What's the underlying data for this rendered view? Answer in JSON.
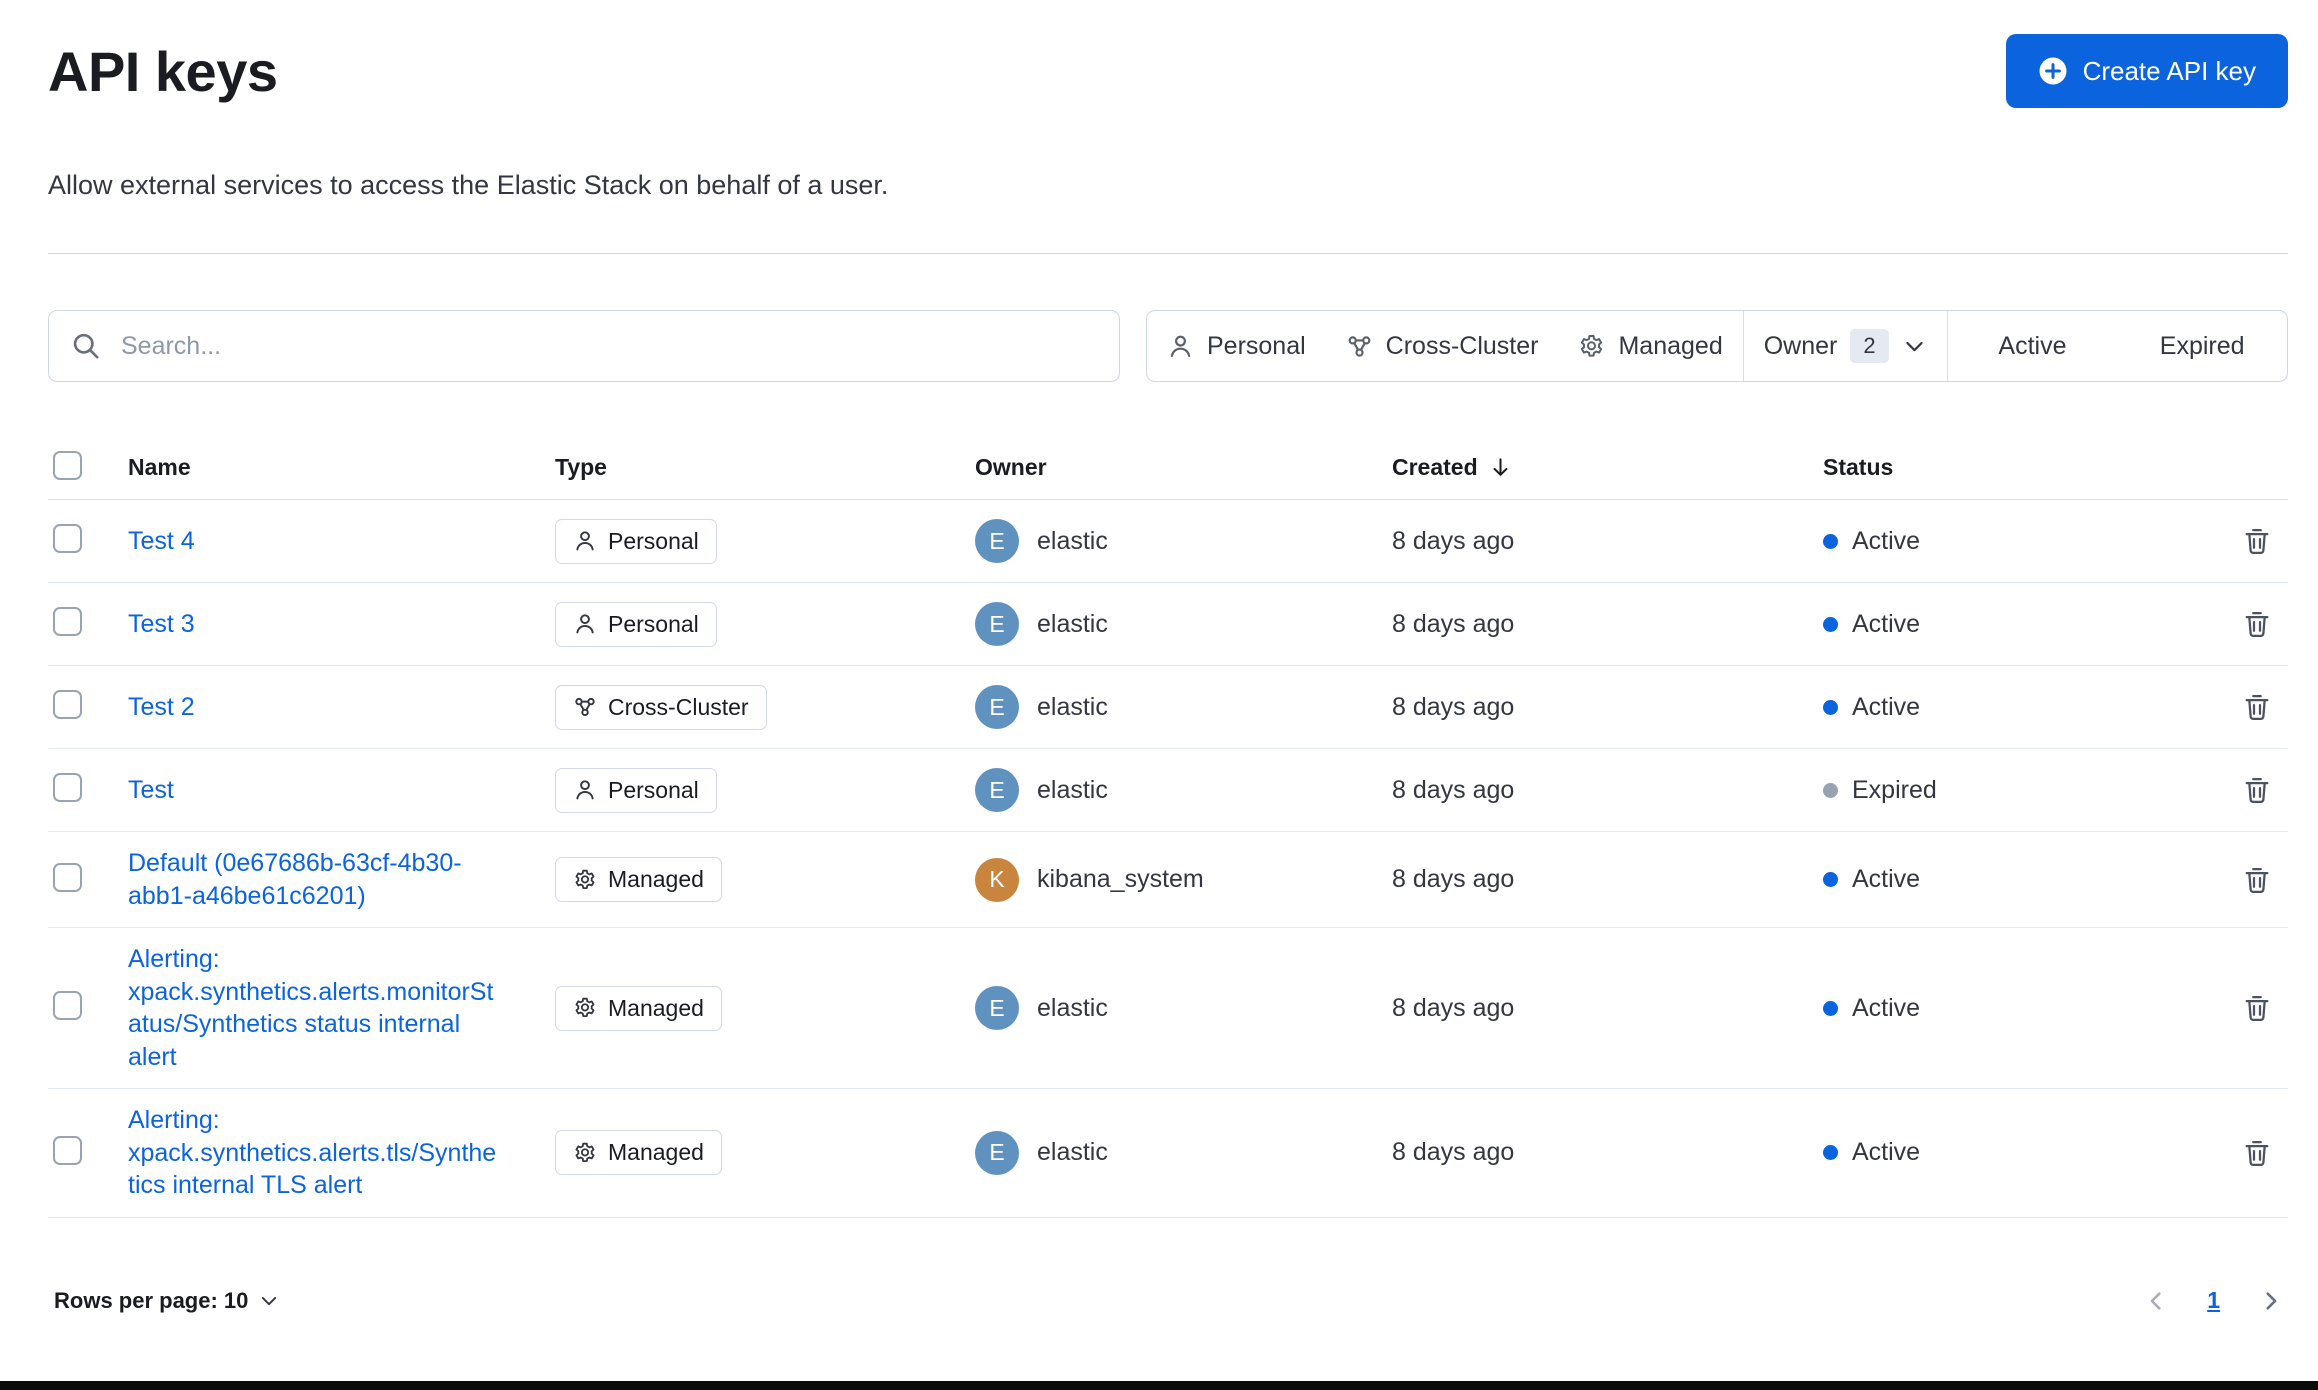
{
  "page": {
    "title": "API keys",
    "subtitle": "Allow external services to access the Elastic Stack on behalf of a user."
  },
  "toolbar": {
    "create_button_label": "Create API key"
  },
  "search": {
    "placeholder": "Search..."
  },
  "filters": {
    "personal_label": "Personal",
    "cross_cluster_label": "Cross-Cluster",
    "managed_label": "Managed",
    "owner_label": "Owner",
    "owner_count": "2",
    "active_label": "Active",
    "expired_label": "Expired"
  },
  "table": {
    "columns": {
      "name": "Name",
      "type": "Type",
      "owner": "Owner",
      "created": "Created",
      "status": "Status"
    },
    "rows": [
      {
        "name": "Test 4",
        "type_label": "Personal",
        "type_kind": "personal",
        "owner": "elastic",
        "owner_initial": "E",
        "avatar_color": "#6092C0",
        "created": "8 days ago",
        "status_label": "Active",
        "status_kind": "active"
      },
      {
        "name": "Test 3",
        "type_label": "Personal",
        "type_kind": "personal",
        "owner": "elastic",
        "owner_initial": "E",
        "avatar_color": "#6092C0",
        "created": "8 days ago",
        "status_label": "Active",
        "status_kind": "active"
      },
      {
        "name": "Test 2",
        "type_label": "Cross-Cluster",
        "type_kind": "cross_cluster",
        "owner": "elastic",
        "owner_initial": "E",
        "avatar_color": "#6092C0",
        "created": "8 days ago",
        "status_label": "Active",
        "status_kind": "active"
      },
      {
        "name": "Test",
        "type_label": "Personal",
        "type_kind": "personal",
        "owner": "elastic",
        "owner_initial": "E",
        "avatar_color": "#6092C0",
        "created": "8 days ago",
        "status_label": "Expired",
        "status_kind": "expired"
      },
      {
        "name": "Default (0e67686b-63cf-4b30-abb1-a46be61c6201)",
        "type_label": "Managed",
        "type_kind": "managed",
        "owner": "kibana_system",
        "owner_initial": "K",
        "avatar_color": "#C9853D",
        "created": "8 days ago",
        "status_label": "Active",
        "status_kind": "active"
      },
      {
        "name": "Alerting: xpack.synthetics.alerts.monitorStatus/Synthetics status internal alert",
        "type_label": "Managed",
        "type_kind": "managed",
        "owner": "elastic",
        "owner_initial": "E",
        "avatar_color": "#6092C0",
        "created": "8 days ago",
        "status_label": "Active",
        "status_kind": "active"
      },
      {
        "name": "Alerting: xpack.synthetics.alerts.tls/Synthetics internal TLS alert",
        "type_label": "Managed",
        "type_kind": "managed",
        "owner": "elastic",
        "owner_initial": "E",
        "avatar_color": "#6092C0",
        "created": "8 days ago",
        "status_label": "Active",
        "status_kind": "active"
      }
    ]
  },
  "pagination": {
    "rows_per_page_label": "Rows per page: 10",
    "current_page": "1"
  },
  "colors": {
    "primary": "#0B64DD",
    "link": "#0B64DD",
    "status_active": "#0B64DD",
    "status_expired": "#98A2B3"
  }
}
